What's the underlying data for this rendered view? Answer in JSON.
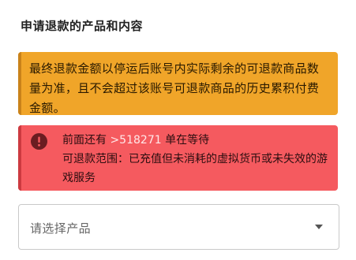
{
  "section": {
    "title": "申请退款的产品和内容"
  },
  "notice": {
    "text": "最终退款金额以停运后账号内实际剩余的可退款商品数量为准，且不会超过该账号可退款商品的历史累积付费金额。",
    "color": "#f0a529"
  },
  "queue": {
    "prefix": "前面还有",
    "count": ">518271",
    "suffix": "单在等待",
    "scope": "可退款范围：已充值但未消耗的虚拟货币或未失效的游戏服务",
    "icon": "info-icon",
    "color": "#f55a5f"
  },
  "product_select": {
    "placeholder": "请选择产品",
    "icon": "chevron-down-icon"
  }
}
